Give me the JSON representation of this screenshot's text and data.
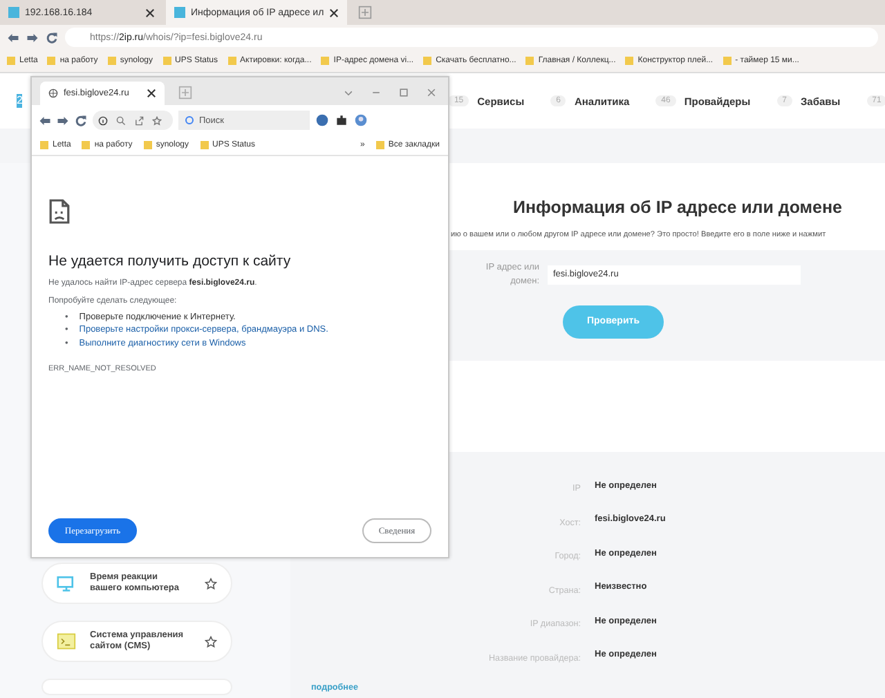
{
  "browser": {
    "tabs": [
      {
        "title": "192.168.16.184",
        "selected": false
      },
      {
        "title": "Информация об IP адресе ил",
        "selected": true
      }
    ],
    "url_scheme": "https://",
    "url_host": "2ip.ru",
    "url_path": "/whois/?ip=fesi.biglove24.ru",
    "bookmarks": [
      "Letta",
      "на работу",
      "synology",
      "UPS Status",
      "Актировки: когда...",
      "IP-адрес домена vi...",
      "Скачать бесплатно...",
      "Главная / Коллекц...",
      "Конструктор плей...",
      "- таймер 15 ми..."
    ]
  },
  "site": {
    "logo_text": "2",
    "nav": [
      {
        "count": "15",
        "label": "Сервисы"
      },
      {
        "count": "6",
        "label": "Аналитика"
      },
      {
        "count": "46",
        "label": "Провайдеры"
      },
      {
        "count": "7",
        "label": "Забавы"
      },
      {
        "count": "71"
      }
    ],
    "title": "Информация об IP адресе или домене",
    "subtitle": "ию о вашем или о любом другом IP адресе или домене? Это просто! Введите его в поле ниже и нажмит",
    "form": {
      "label": "IP адрес или домен:",
      "value": "fesi.biglove24.ru",
      "button": "Проверить"
    },
    "results": [
      {
        "label": "IP",
        "value": "Не определен"
      },
      {
        "label": "Хост:",
        "value": "fesi.biglove24.ru"
      },
      {
        "label": "Город:",
        "value": "Не определен"
      },
      {
        "label": "Страна:",
        "value": "Неизвестно"
      },
      {
        "label": "IP диапазон:",
        "value": "Не определен"
      },
      {
        "label": "Название провайдера:",
        "value": "Не определен"
      }
    ],
    "more_link": "подробнее",
    "sidebar": [
      {
        "title": "Время реакции вашего компьютера",
        "kind": "monitor"
      },
      {
        "title": "Система управления сайтом (CMS)",
        "kind": "terminal"
      }
    ]
  },
  "popup": {
    "tab": "fesi.biglove24.ru",
    "search_placeholder": "Поиск",
    "bookmarks": [
      "Letta",
      "на работу",
      "synology",
      "UPS Status"
    ],
    "overflow": "»",
    "all_bookmarks": "Все закладки",
    "error": {
      "heading": "Не удается получить доступ к сайту",
      "message": "Не удалось найти IP-адрес сервера **fesi.biglove24.ru**.",
      "suggest": "Попробуйте сделать следующее:",
      "items": [
        {
          "bullet": "•",
          "text": "Проверьте подключение к Интернету.",
          "kind": "text"
        },
        {
          "bullet": "•",
          "text": "Проверьте настройки прокси-сервера, брандмауэра и DNS.",
          "kind": "link"
        },
        {
          "bullet": "•",
          "text": "Выполните диагностику сети в Windows",
          "kind": "link"
        }
      ],
      "code": "ERR_NAME_NOT_RESOLVED",
      "reload": "Перезагрузить",
      "details": "Сведения"
    }
  }
}
